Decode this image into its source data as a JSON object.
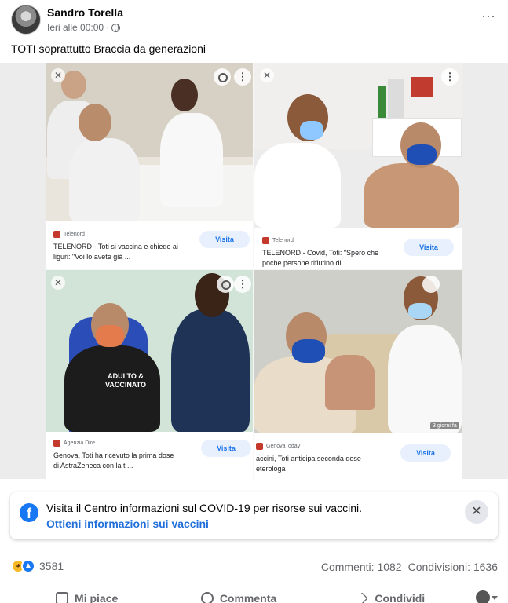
{
  "post": {
    "author": "Sandro Torella",
    "time": "Ieri alle 00:00 ·",
    "text": "TOTI   soprattutto Braccia da generazioni"
  },
  "collage": {
    "cards": [
      {
        "source": "Telenord",
        "caption_line1": "TELENORD - Toti si vaccina e chiede ai",
        "caption_line2": "liguri: \"Voi lo avete già ...",
        "button": "Visita"
      },
      {
        "source": "Telenord",
        "caption_line1": "TELENORD - Covid, Toti: \"Spero che",
        "caption_line2": "poche persone rifiutino di ...",
        "button": "Visita"
      },
      {
        "source": "Agenzia Dire",
        "caption_line1": "Genova, Toti ha ricevuto la prima dose",
        "caption_line2": "di AstraZeneca con la t ...",
        "button": "Visita",
        "shirt_line1": "ADULTO &",
        "shirt_line2": "VACCINATO"
      },
      {
        "source": "GenovaToday",
        "caption_line1": "accini, Toti anticipa seconda dose",
        "caption_line2": "eterologa",
        "button": "Visita",
        "badge": "3 giorni fa"
      }
    ]
  },
  "notice": {
    "text": "Visita il Centro informazioni sul COVID-19 per risorse sui vaccini.",
    "link": "Ottieni informazioni sui vaccini",
    "close": "✕"
  },
  "stats": {
    "reactions_count": "3581",
    "comments": "Commenti: 1082",
    "shares": "Condivisioni: 1636"
  },
  "actions": {
    "like": "Mi piace",
    "comment": "Commenta",
    "share": "Condividi"
  },
  "colors": {
    "fb_blue": "#1877f2",
    "link_blue": "#216fdb",
    "visita_bg": "#e8f0fe",
    "visita_text": "#1a73e8"
  }
}
